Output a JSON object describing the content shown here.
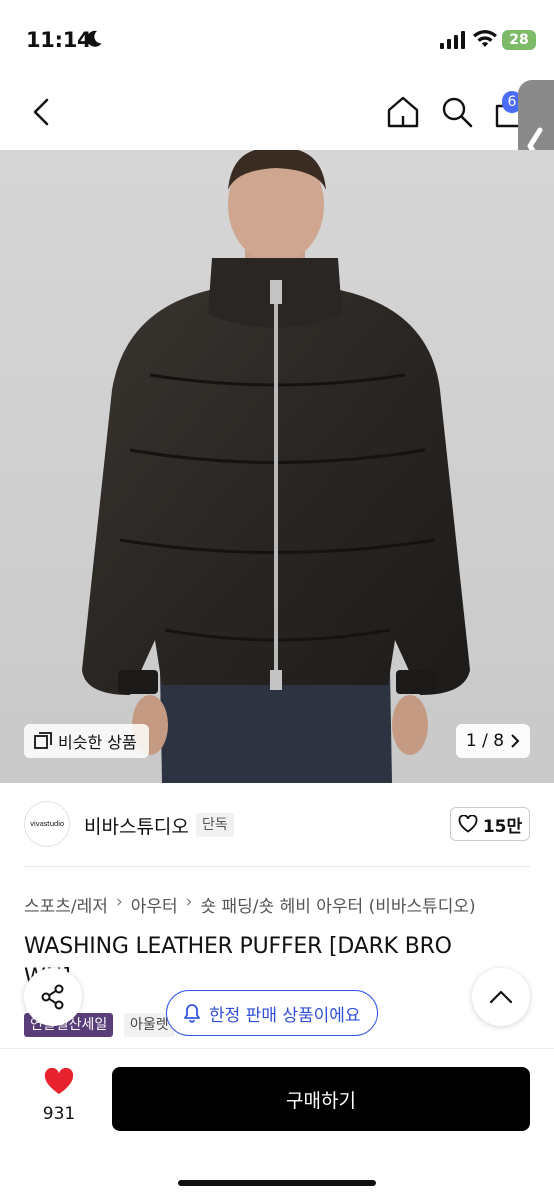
{
  "status_bar": {
    "time": "11:14",
    "battery": "28"
  },
  "nav": {
    "cart_count": "6"
  },
  "gallery": {
    "similar_label": "비슷한 상품",
    "page": "1 / 8"
  },
  "brand": {
    "logo_text": "vivastudio",
    "name": "비바스튜디오",
    "tag": "단독",
    "likes": "15만"
  },
  "breadcrumb": [
    "스포츠/레저",
    "아우터",
    "숏 패딩/숏 헤비 아우터 (비바스튜디오)"
  ],
  "product": {
    "title": "WASHING LEATHER PUFFER [DARK BRO",
    "title_cont": "WN]",
    "tags": [
      "연말결산세일",
      "아울렛"
    ]
  },
  "floating": {
    "limited_label": "한정 판매 상품이에요"
  },
  "bottom": {
    "heart_count": "931",
    "buy_label": "구매하기"
  },
  "colors": {
    "accent_blue": "#3355e6",
    "heart_red": "#e8232f",
    "sale_purple": "#5a3e7a"
  }
}
